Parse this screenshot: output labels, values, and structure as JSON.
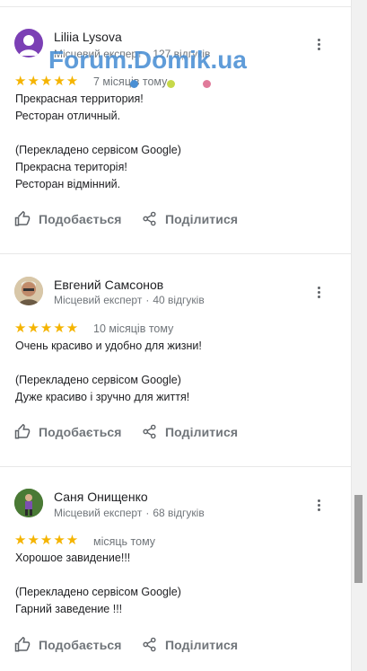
{
  "reviews": [
    {
      "name": "Liliia Lysova",
      "role": "Місцевий експерт",
      "reviews_count": "127 відгуків",
      "rating": 5,
      "stars": "★★★★★",
      "date": "7 місяців тому",
      "lines": [
        "Прекрасная территория!",
        "Ресторан отличный.",
        "",
        "(Перекладено сервісом Google)",
        "Прекрасна територія!",
        "Ресторан відмінний."
      ]
    },
    {
      "name": "Евгений Самсонов",
      "role": "Місцевий експерт",
      "reviews_count": "40 відгуків",
      "rating": 5,
      "stars": "★★★★★",
      "date": "10 місяців тому",
      "lines": [
        "Очень красиво и удобно для жизни!",
        "",
        "(Перекладено сервісом Google)",
        "Дуже красиво і зручно для життя!"
      ]
    },
    {
      "name": "Саня Онищенко",
      "role": "Місцевий експерт",
      "reviews_count": "68 відгуків",
      "rating": 5,
      "stars": "★★★★★",
      "date": "місяць тому",
      "lines": [
        "Хорошое завидение!!!",
        "",
        "(Перекладено сервісом Google)",
        "Гарний заведение !!!"
      ]
    }
  ],
  "actions": {
    "like_label": "Подобається",
    "share_label": "Поділитися"
  },
  "watermark": "Forum.Domik.ua",
  "colors": {
    "star": "#f5b400",
    "watermark": "#4a8fd4",
    "meta_text": "#70757a"
  },
  "icons": [
    "more-vert-icon",
    "thumb-up-icon",
    "share-icon"
  ]
}
